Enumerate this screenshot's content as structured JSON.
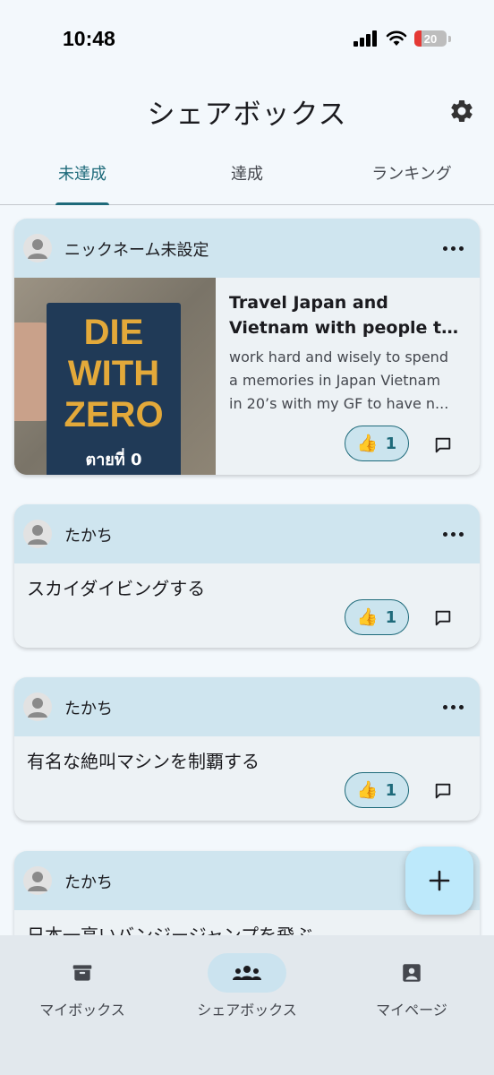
{
  "status_bar": {
    "time": "10:48",
    "battery": "20"
  },
  "header": {
    "title": "シェアボックス"
  },
  "tabs": [
    {
      "label": "未達成",
      "active": true
    },
    {
      "label": "達成",
      "active": false
    },
    {
      "label": "ランキング",
      "active": false
    }
  ],
  "cards": [
    {
      "username": "ニックネーム未設定",
      "title_lines": [
        "Travel Japan and",
        "Vietnam with people th..."
      ],
      "body_lines": [
        "work hard and wisely to spend",
        "a memories in Japan Vietnam",
        "in 20’s with my GF to have n..."
      ],
      "likes": "1",
      "photo": {
        "book_title": "DIE\nWITH\nZERO",
        "book_subtitle": "ตายที่ 0"
      }
    },
    {
      "username": "たかち",
      "goal": "スカイダイビングする",
      "likes": "1"
    },
    {
      "username": "たかち",
      "goal": "有名な絶叫マシンを制覇する",
      "likes": "1"
    },
    {
      "username": "たかち",
      "goal": "日本一高いバンジージャンプを飛ぶ"
    }
  ],
  "bottom_nav": [
    {
      "label": "マイボックス",
      "icon": "box-icon",
      "active": false
    },
    {
      "label": "シェアボックス",
      "icon": "group-icon",
      "active": true
    },
    {
      "label": "マイページ",
      "icon": "account-box-icon",
      "active": false
    }
  ],
  "colors": {
    "accent": "#1e6a7a",
    "card_header": "#cfe5ef",
    "fab": "#bde9fb"
  }
}
